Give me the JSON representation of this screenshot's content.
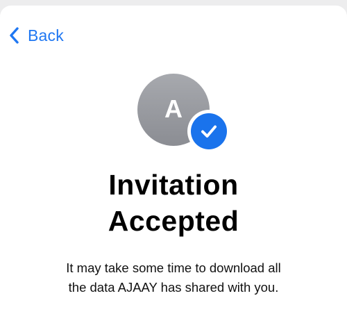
{
  "nav": {
    "back_label": "Back",
    "back_icon": "chevron-left-icon"
  },
  "avatar": {
    "initial": "A",
    "badge_icon": "checkmark-icon"
  },
  "content": {
    "title_line1": "Invitation",
    "title_line2": "Accepted",
    "message_line1": "It may take some time to download all",
    "message_line2": "the data AJAAY has shared with you."
  },
  "colors": {
    "accent": "#1f77f2",
    "badge": "#1a73ec",
    "avatar": "#9a9ca1",
    "background": "#ffffff"
  }
}
